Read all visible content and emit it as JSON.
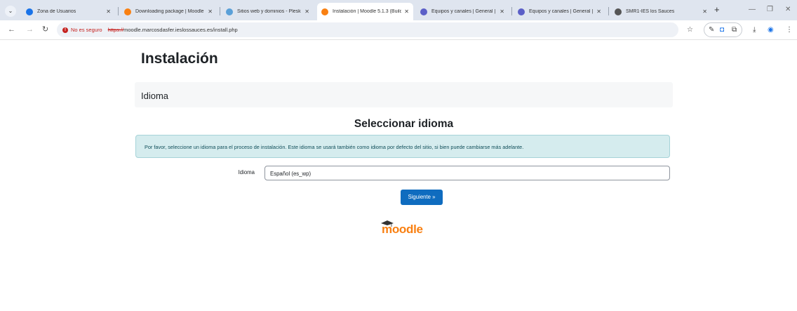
{
  "browser": {
    "tabs": [
      {
        "title": "Zona de Usuarios",
        "favicon_color": "#1a73e8",
        "active": false
      },
      {
        "title": "Downloading package | Moodle",
        "favicon_color": "#f98012",
        "active": false
      },
      {
        "title": "Sitios web y dominios - Plesk",
        "favicon_color": "#5aa0d8",
        "active": false
      },
      {
        "title": "Instalación | Moodle 5.1.3 (Build",
        "favicon_color": "#f98012",
        "active": true
      },
      {
        "title": "Equipos y canales | General | M",
        "favicon_color": "#5b5fc7",
        "active": false
      },
      {
        "title": "Equipos y canales | General | M",
        "favicon_color": "#5b5fc7",
        "active": false
      },
      {
        "title": "SMR1-IES los Sauces",
        "favicon_color": "#555555",
        "active": false
      }
    ],
    "new_tab_label": "+",
    "address": {
      "security_label": "No es seguro",
      "scheme": "https://",
      "url": "moodle.marcosdasfer.ieslossauces.es/install.php"
    }
  },
  "page": {
    "title": "Instalación",
    "section_heading": "Idioma",
    "subheading": "Seleccionar idioma",
    "info_text": "Por favor, seleccione un idioma para el proceso de instalación. Este idioma se usará también como idioma por defecto del sitio, si bien puede cambiarse más adelante.",
    "language_label": "Idioma",
    "language_selected": "Español (es_wp)",
    "next_button": "Siguiente »",
    "logo_text": "moodle"
  },
  "colors": {
    "primary": "#0f6cbf",
    "info_bg": "#d5ecee",
    "logo": "#f98012",
    "insecure": "#c5221f"
  }
}
